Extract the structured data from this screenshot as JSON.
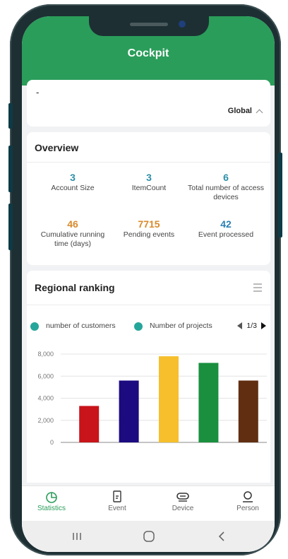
{
  "app": {
    "title": "Cockpit"
  },
  "scope": {
    "placeholder": "-",
    "selected": "Global"
  },
  "overview": {
    "title": "Overview",
    "stats": [
      {
        "value": "3",
        "label": "Account Size",
        "color": "#2d8fa8"
      },
      {
        "value": "3",
        "label": "ItemCount",
        "color": "#2d8fa8"
      },
      {
        "value": "6",
        "label": "Total number of access devices",
        "color": "#2d8fa8"
      },
      {
        "value": "46",
        "label": "Cumulative running time (days)",
        "color": "#d98a2b"
      },
      {
        "value": "7715",
        "label": "Pending events",
        "color": "#d98a2b"
      },
      {
        "value": "42",
        "label": "Event processed",
        "color": "#2d7fb2"
      }
    ]
  },
  "ranking": {
    "title": "Regional ranking",
    "legend": [
      "number of customers",
      "Number of projects"
    ],
    "page": "1/3"
  },
  "chart_data": {
    "type": "bar",
    "categories": [
      "",
      "",
      "",
      "",
      ""
    ],
    "values": [
      3300,
      5600,
      7800,
      7200,
      5600
    ],
    "colors": [
      "#c8141a",
      "#1b0a80",
      "#f6bf2b",
      "#1a8f3e",
      "#612e12"
    ],
    "yticks": [
      "8,000",
      "6,000",
      "4,000",
      "2,000",
      "0"
    ],
    "ylim": [
      0,
      8000
    ]
  },
  "tabs": [
    {
      "label": "Statistics",
      "icon": "pie-chart-icon",
      "active": true
    },
    {
      "label": "Event",
      "icon": "document-icon",
      "active": false
    },
    {
      "label": "Device",
      "icon": "device-icon",
      "active": false
    },
    {
      "label": "Person",
      "icon": "person-icon",
      "active": false
    }
  ],
  "colors": {
    "brand": "#2a9d5a",
    "legend_dot": "#26a69a"
  }
}
